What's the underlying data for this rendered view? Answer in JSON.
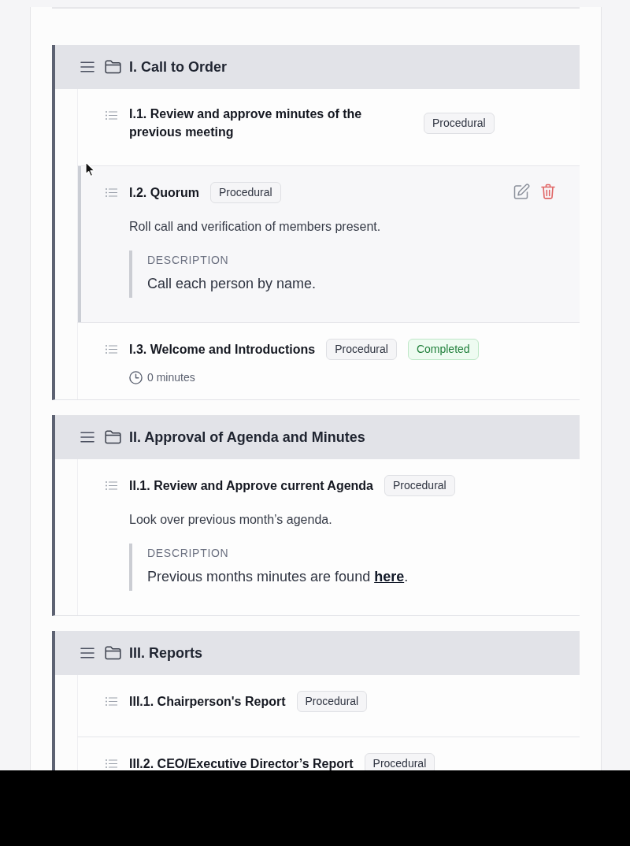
{
  "sections": [
    {
      "title": "I. Call to Order",
      "items": [
        {
          "title": "I.1. Review and approve minutes of the previous meeting",
          "selected": false,
          "tags": [
            {
              "label": "Procedural",
              "kind": "category"
            }
          ]
        },
        {
          "title": "I.2. Quorum",
          "selected": true,
          "tags": [
            {
              "label": "Procedural",
              "kind": "category"
            }
          ],
          "summary": "Roll call and verification of members present.",
          "description": {
            "label": "DESCRIPTION",
            "segments": [
              {
                "kind": "text",
                "text": "Call each person by name."
              }
            ]
          }
        },
        {
          "title": "I.3. Welcome and Introductions",
          "selected": false,
          "tags": [
            {
              "label": "Procedural",
              "kind": "category"
            },
            {
              "label": "Completed",
              "kind": "status"
            }
          ],
          "duration": "0 minutes"
        }
      ]
    },
    {
      "title": "II. Approval of Agenda and Minutes",
      "items": [
        {
          "title": "II.1. Review and Approve current Agenda",
          "selected": false,
          "tags": [
            {
              "label": "Procedural",
              "kind": "category"
            }
          ],
          "summary": "Look over previous month’s agenda.",
          "description": {
            "label": "DESCRIPTION",
            "segments": [
              {
                "kind": "text",
                "text": "Previous months minutes are found "
              },
              {
                "kind": "link",
                "text": "here"
              },
              {
                "kind": "text",
                "text": "."
              }
            ]
          }
        }
      ]
    },
    {
      "title": "III. Reports",
      "items": [
        {
          "title": "III.1. Chairperson's Report",
          "selected": false,
          "tags": [
            {
              "label": "Procedural",
              "kind": "category"
            }
          ]
        },
        {
          "title": "III.2. CEO/Executive Director’s Report",
          "selected": false,
          "tags": [
            {
              "label": "Procedural",
              "kind": "category"
            }
          ]
        }
      ]
    }
  ]
}
